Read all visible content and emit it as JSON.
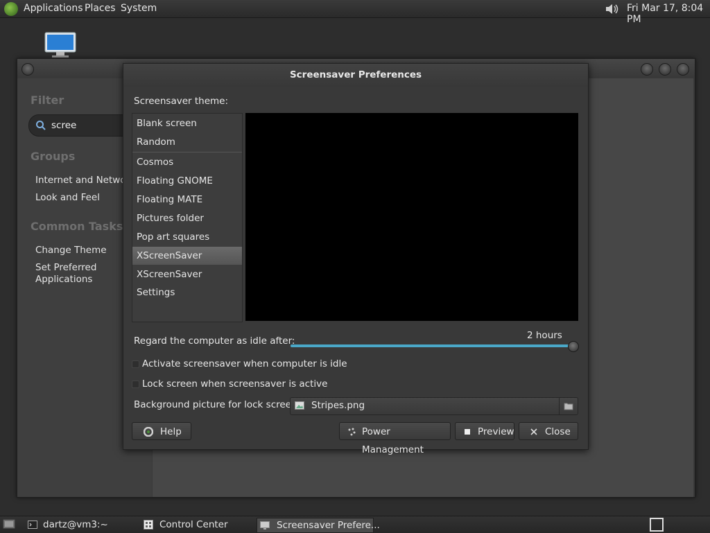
{
  "top_panel": {
    "menu": [
      "Applications",
      "Places",
      "System"
    ],
    "clock": "Fri Mar 17,  8:04 PM"
  },
  "control_center": {
    "filter_heading": "Filter",
    "search_value": "scree",
    "groups_heading": "Groups",
    "groups": [
      "Internet and Network",
      "Look and Feel"
    ],
    "common_tasks_heading": "Common Tasks",
    "tasks": [
      "Change Theme",
      "Set Preferred\nApplications"
    ]
  },
  "dialog": {
    "title": "Screensaver Preferences",
    "theme_label": "Screensaver theme:",
    "themes": [
      "Blank screen",
      "Random",
      "Cosmos",
      "Floating GNOME",
      "Floating MATE",
      "Pictures folder",
      "Pop art squares",
      "XScreenSaver",
      "XScreenSaver Settings"
    ],
    "selected_theme": "XScreenSaver",
    "idle_label": "Regard the computer as idle after:",
    "idle_value": "2 hours",
    "idle_fraction": 1.0,
    "activate_label": "Activate screensaver when computer is idle",
    "activate_checked": false,
    "lock_label": "Lock screen when screensaver is active",
    "lock_checked": false,
    "bg_label": "Background picture for lock screen:",
    "bg_file": "Stripes.png",
    "buttons": {
      "help": "Help",
      "power": "Power Management",
      "preview": "Preview",
      "close": "Close"
    }
  },
  "taskbar": {
    "tasks": [
      "dartz@vm3:~",
      "Control Center",
      "Screensaver Prefere..."
    ],
    "active_task": "Screensaver Prefere..."
  },
  "colors": {
    "accent": "#4aa8c8",
    "panel": "#2a2a2a",
    "dialog_bg": "#393939"
  }
}
